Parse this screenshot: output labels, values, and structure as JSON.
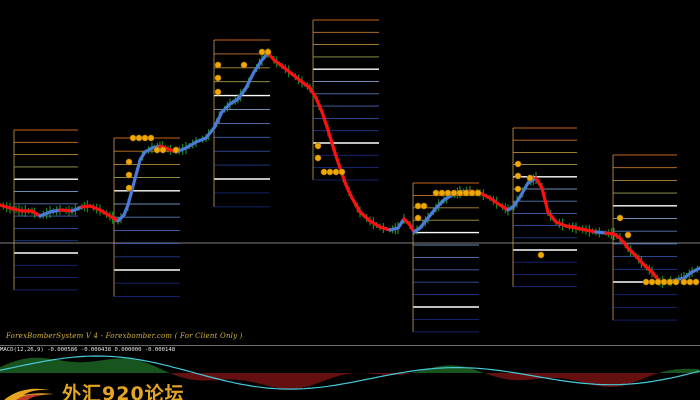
{
  "chart": {
    "footer": "ForexBomberSystem V 4 - Forexbomber.com ( For Client Only )",
    "indicator_label": "MACD(12,26,9) -0.000586 -0.000438 0.000000 -0.000148",
    "watermark": "外汇920论坛"
  },
  "colors": {
    "background": "#000000",
    "bull": "#4a7bd8",
    "bear": "#ff1010",
    "marker": "#f0a800",
    "candle": "#25a02a",
    "baseline": "#808080",
    "macd_line": "#48c8d8",
    "watermark": "#e5a521"
  }
}
